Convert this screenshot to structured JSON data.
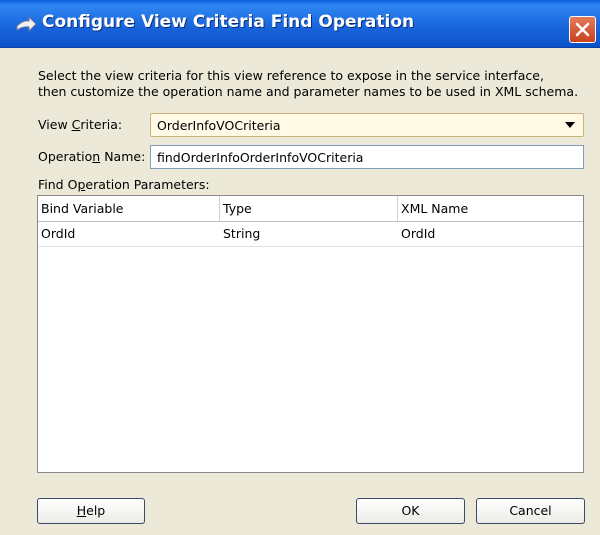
{
  "window": {
    "title": "Configure View Criteria Find Operation"
  },
  "description": {
    "line1": "Select the view criteria for this view reference to expose in the service interface,",
    "line2": "then customize the operation name and parameter names to be used in XML schema."
  },
  "view_criteria": {
    "label_pre": "View ",
    "label_mnemonic": "C",
    "label_post": "riteria:",
    "selected": "OrderInfoVOCriteria"
  },
  "operation_name": {
    "label_pre": "Operatio",
    "label_mnemonic": "n",
    "label_post": " Name:",
    "value": "findOrderInfoOrderInfoVOCriteria"
  },
  "parameters": {
    "label_pre": "Find O",
    "label_mnemonic": "p",
    "label_post": "eration Parameters:",
    "columns": [
      "Bind Variable",
      "Type",
      "XML Name"
    ],
    "rows": [
      [
        "OrdId",
        "String",
        "OrdId"
      ]
    ]
  },
  "buttons": {
    "help_mnemonic": "H",
    "help_rest": "elp",
    "ok": "OK",
    "cancel": "Cancel"
  }
}
